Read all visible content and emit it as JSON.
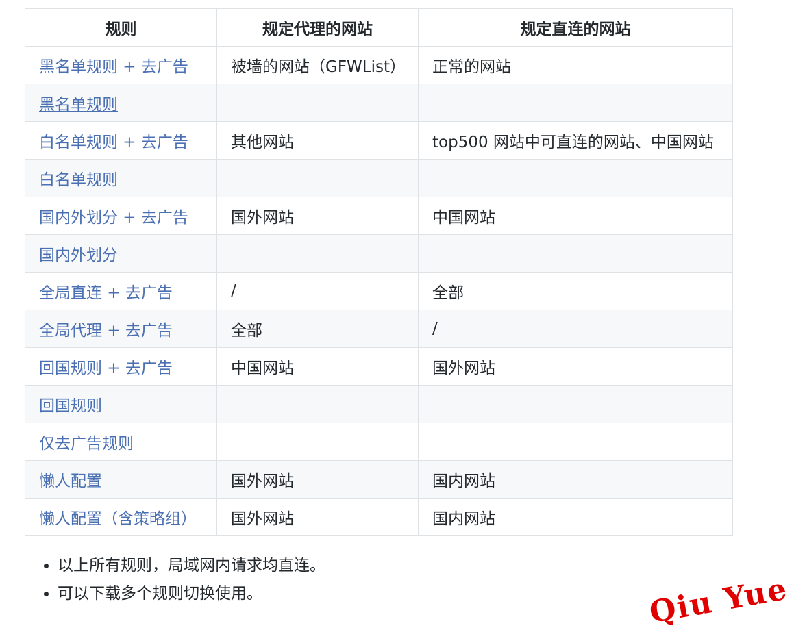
{
  "table": {
    "headers": [
      "规则",
      "规定代理的网站",
      "规定直连的网站"
    ],
    "rows": [
      {
        "rule": "黑名单规则 + 去广告",
        "proxy": "被墙的网站（GFWList）",
        "direct": "正常的网站"
      },
      {
        "rule": "黑名单规则",
        "proxy": "",
        "direct": ""
      },
      {
        "rule": "白名单规则 + 去广告",
        "proxy": "其他网站",
        "direct": "top500 网站中可直连的网站、中国网站"
      },
      {
        "rule": "白名单规则",
        "proxy": "",
        "direct": ""
      },
      {
        "rule": "国内外划分 + 去广告",
        "proxy": "国外网站",
        "direct": "中国网站"
      },
      {
        "rule": "国内外划分",
        "proxy": "",
        "direct": ""
      },
      {
        "rule": "全局直连 + 去广告",
        "proxy": "/",
        "direct": "全部"
      },
      {
        "rule": "全局代理 + 去广告",
        "proxy": "全部",
        "direct": "/"
      },
      {
        "rule": "回国规则 + 去广告",
        "proxy": "中国网站",
        "direct": "国外网站"
      },
      {
        "rule": "回国规则",
        "proxy": "",
        "direct": ""
      },
      {
        "rule": "仅去广告规则",
        "proxy": "",
        "direct": ""
      },
      {
        "rule": "懒人配置",
        "proxy": "国外网站",
        "direct": "国内网站"
      },
      {
        "rule": "懒人配置（含策略组）",
        "proxy": "国外网站",
        "direct": "国内网站"
      }
    ]
  },
  "notes": [
    "以上所有规则，局域网内请求均直连。",
    "可以下载多个规则切换使用。"
  ],
  "watermark": "Qiu Yue",
  "colors": {
    "link": "#4a70b3",
    "border": "#dfe2e5",
    "stripe": "#f6f8fa",
    "watermark": "#e00000"
  }
}
